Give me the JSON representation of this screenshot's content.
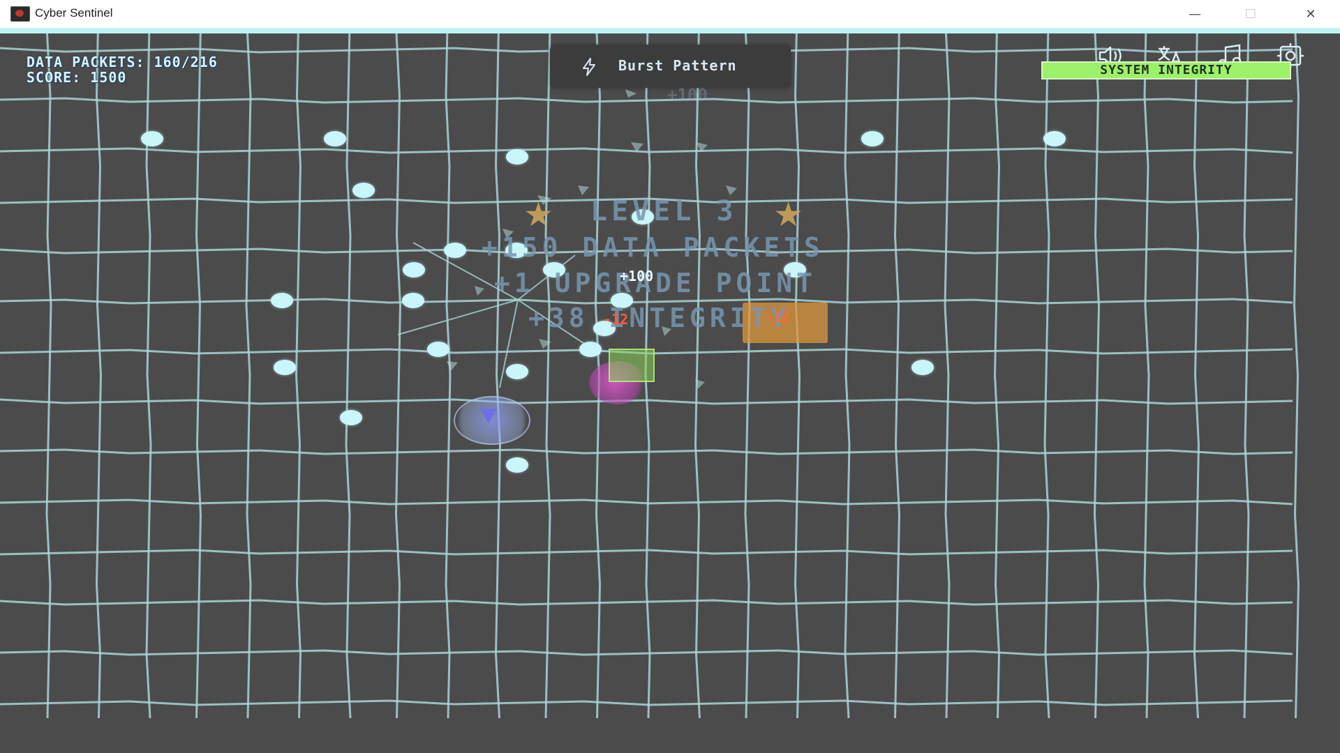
{
  "window": {
    "title": "Cyber Sentinel",
    "controls": {
      "minimize": "—",
      "maximize": "☐",
      "close": "✕"
    }
  },
  "hud": {
    "data_packets_label": "DATA PACKETS: 160/216",
    "score_label": "SCORE: 1500"
  },
  "attack": {
    "icon": "bolt-icon",
    "label": "Burst Pattern"
  },
  "controls": [
    {
      "name": "sound-icon",
      "label": "sound"
    },
    {
      "name": "language-icon",
      "label": "language"
    },
    {
      "name": "music-icon",
      "label": "music"
    },
    {
      "name": "settings-icon",
      "label": "settings"
    }
  ],
  "integrity": {
    "label": "SYSTEM INTEGRITY",
    "color": "#9df06a"
  },
  "level_up": {
    "level": "LEVEL 3",
    "packets": "+150 DATA PACKETS",
    "upgrade": "+1 UPGRADE POINT",
    "integrity": "+38 INTEGRITY",
    "star": "★"
  },
  "floating_text": {
    "plus_a": "+100",
    "plus_b": "+100",
    "minus_a": "-12",
    "minus_b": "-12"
  },
  "colors": {
    "background": "#4b4b4b",
    "grid": "#a9d4d6",
    "packet": "#c8f6fb",
    "damage": "#ff5a3a",
    "enemy": "#de963c"
  }
}
